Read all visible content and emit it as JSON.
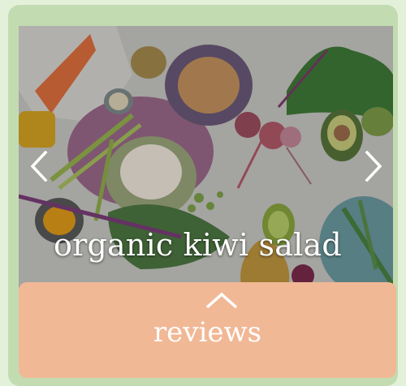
{
  "slide": {
    "caption": "organic kiwi salad",
    "image": "food-ingredients-photo"
  },
  "carousel": {
    "prev_icon": "chevron-left-icon",
    "next_icon": "chevron-right-icon"
  },
  "reviews_panel": {
    "label": "reviews",
    "toggle_icon": "chevron-up-icon"
  },
  "colors": {
    "page_background": "#e3f1da",
    "card_background": "#c3dbb1",
    "panel_background": "#f1b896",
    "text": "#ffffff"
  }
}
